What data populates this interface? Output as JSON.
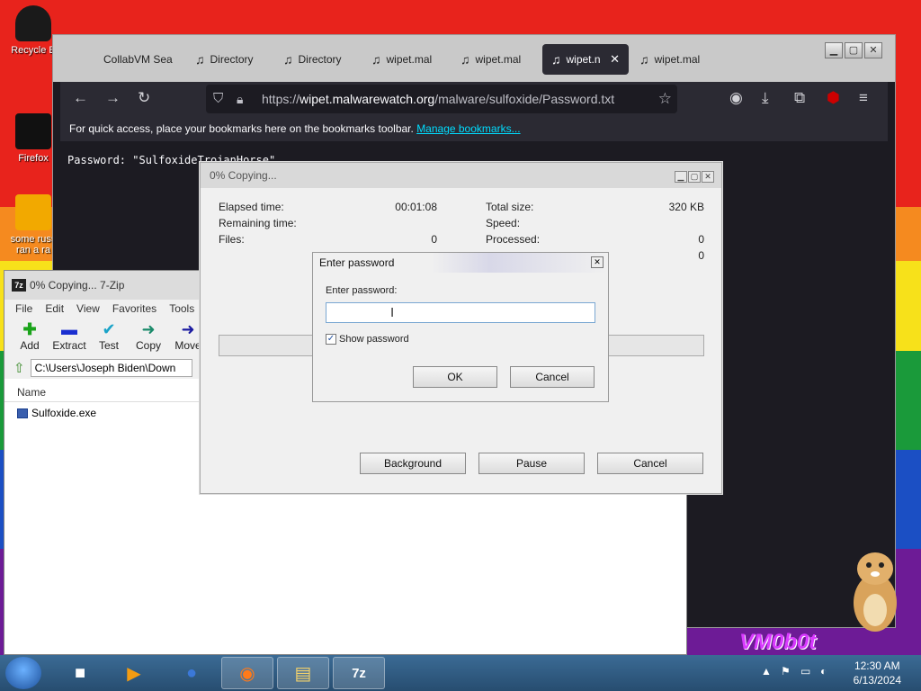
{
  "desktop": {
    "icons": [
      {
        "label": "Recycle B"
      },
      {
        "label": "Firefox"
      },
      {
        "label": "some russ\nran a ra"
      }
    ]
  },
  "firefox": {
    "tabs": [
      {
        "label": "CollabVM Sea"
      },
      {
        "label": "Directory"
      },
      {
        "label": "Directory"
      },
      {
        "label": "wipet.mal"
      },
      {
        "label": "wipet.mal"
      },
      {
        "label": "wipet.n"
      },
      {
        "label": "wipet.mal"
      }
    ],
    "url_host": "wipet.malwarewatch.org",
    "url_prefix": "https://",
    "url_path": "/malware/sulfoxide/Password.txt",
    "bookmarks_text": "For quick access, place your bookmarks here on the bookmarks toolbar. ",
    "bookmarks_link": "Manage bookmarks...",
    "content_text": "Password: \"SulfoxideTrojanHorse\""
  },
  "sevenzip": {
    "title": "0% Copying... 7-Zip",
    "menu": [
      "File",
      "Edit",
      "View",
      "Favorites",
      "Tools"
    ],
    "toolbar": [
      {
        "label": "Add",
        "icon": "+",
        "color": "#1aa31a"
      },
      {
        "label": "Extract",
        "icon": "▬",
        "color": "#1a2fd0"
      },
      {
        "label": "Test",
        "icon": "✔",
        "color": "#1aa3c8"
      },
      {
        "label": "Copy",
        "icon": "➜",
        "color": "#1a8a6a"
      },
      {
        "label": "Move",
        "icon": "➜",
        "color": "#1a1aa0"
      }
    ],
    "path": "C:\\Users\\Joseph Biden\\Down",
    "column_name": "Name",
    "files": [
      "Sulfoxide.exe"
    ]
  },
  "copy_dialog": {
    "title": "0% Copying...",
    "elapsed_label": "Elapsed time:",
    "elapsed_value": "00:01:08",
    "remaining_label": "Remaining time:",
    "files_label": "Files:",
    "files_value": "0",
    "total_size_label": "Total size:",
    "total_size_value": "320 KB",
    "speed_label": "Speed:",
    "processed_label": "Processed:",
    "processed_value": "0",
    "extra_value": "0",
    "progress": 0,
    "btn_background": "Background",
    "btn_pause": "Pause",
    "btn_cancel": "Cancel"
  },
  "password_dialog": {
    "title": "Enter password",
    "label": "Enter password:",
    "value": "",
    "show_password_label": "Show password",
    "show_password_checked": true,
    "ok": "OK",
    "cancel": "Cancel"
  },
  "vm_badge": "VM0b0t",
  "taskbar": {
    "time": "12:30 AM",
    "date": "6/13/2024"
  }
}
